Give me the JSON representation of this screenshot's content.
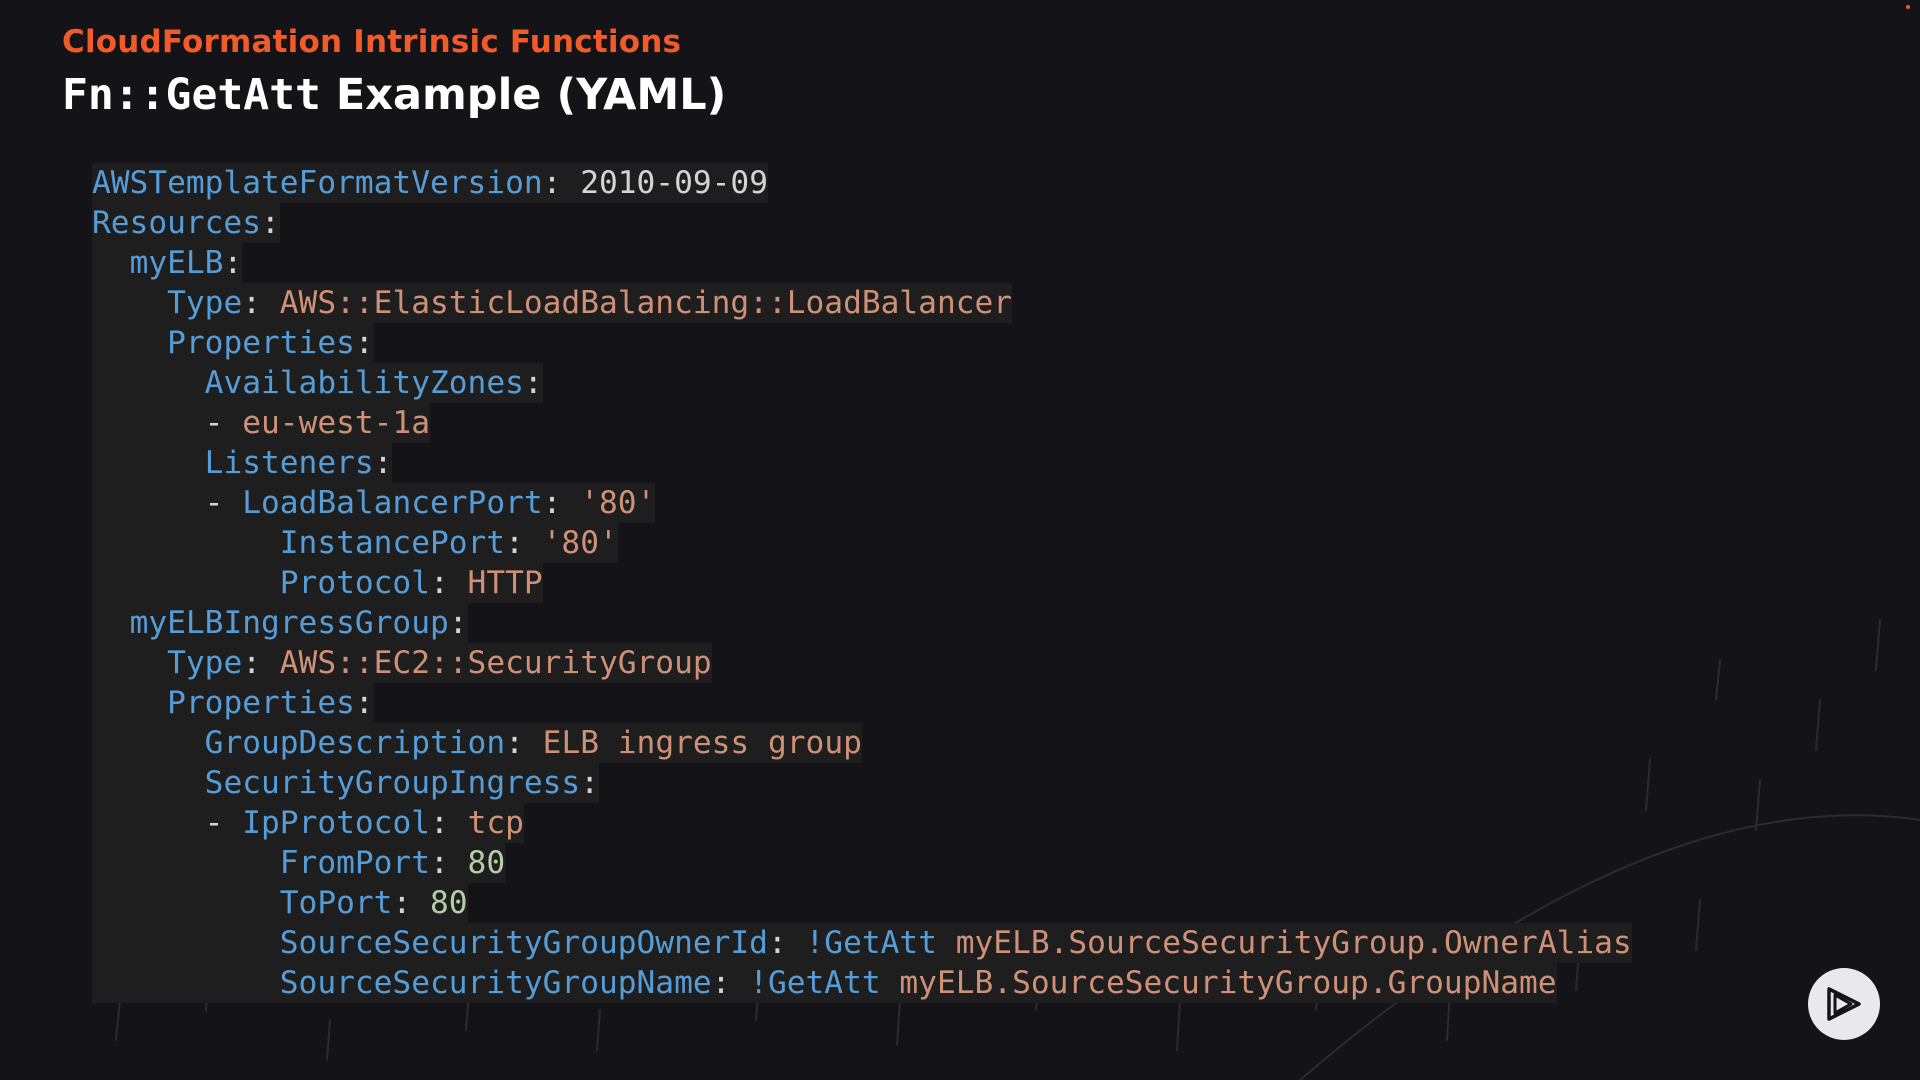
{
  "header": {
    "eyebrow": "CloudFormation Intrinsic Functions",
    "title_code": "Fn::GetAtt",
    "title_rest": " Example (YAML)"
  },
  "code": {
    "language": "yaml",
    "lines": [
      {
        "indent": 0,
        "key": "AWSTemplateFormatVersion",
        "sep": ": ",
        "value": "2010-09-09",
        "type": "plain"
      },
      {
        "indent": 0,
        "key": "Resources",
        "sep": ":",
        "value": "",
        "type": "none"
      },
      {
        "indent": 2,
        "key": "myELB",
        "sep": ":",
        "value": "",
        "type": "none"
      },
      {
        "indent": 4,
        "key": "Type",
        "sep": ": ",
        "value": "AWS::ElasticLoadBalancing::LoadBalancer",
        "type": "string"
      },
      {
        "indent": 4,
        "key": "Properties",
        "sep": ":",
        "value": "",
        "type": "none"
      },
      {
        "indent": 6,
        "key": "AvailabilityZones",
        "sep": ":",
        "value": "",
        "type": "none"
      },
      {
        "indent": 8,
        "dash": true,
        "key": "",
        "sep": "",
        "value": "eu-west-1a",
        "type": "string"
      },
      {
        "indent": 6,
        "key": "Listeners",
        "sep": ":",
        "value": "",
        "type": "none"
      },
      {
        "indent": 8,
        "dash": true,
        "key": "LoadBalancerPort",
        "sep": ": ",
        "value": "'80'",
        "type": "string"
      },
      {
        "indent": 10,
        "key": "InstancePort",
        "sep": ": ",
        "value": "'80'",
        "type": "string"
      },
      {
        "indent": 10,
        "key": "Protocol",
        "sep": ": ",
        "value": "HTTP",
        "type": "string"
      },
      {
        "indent": 2,
        "key": "myELBIngressGroup",
        "sep": ":",
        "value": "",
        "type": "none"
      },
      {
        "indent": 4,
        "key": "Type",
        "sep": ": ",
        "value": "AWS::EC2::SecurityGroup",
        "type": "string"
      },
      {
        "indent": 4,
        "key": "Properties",
        "sep": ":",
        "value": "",
        "type": "none"
      },
      {
        "indent": 6,
        "key": "GroupDescription",
        "sep": ": ",
        "value": "ELB ingress group",
        "type": "string"
      },
      {
        "indent": 6,
        "key": "SecurityGroupIngress",
        "sep": ":",
        "value": "",
        "type": "none"
      },
      {
        "indent": 8,
        "dash": true,
        "key": "IpProtocol",
        "sep": ": ",
        "value": "tcp",
        "type": "string"
      },
      {
        "indent": 10,
        "key": "FromPort",
        "sep": ": ",
        "value": "80",
        "type": "number"
      },
      {
        "indent": 10,
        "key": "ToPort",
        "sep": ": ",
        "value": "80",
        "type": "number"
      },
      {
        "indent": 10,
        "key": "SourceSecurityGroupOwnerId",
        "sep": ": ",
        "tag": "!GetAtt",
        "value": "myELB.SourceSecurityGroup.OwnerAlias",
        "type": "string"
      },
      {
        "indent": 10,
        "key": "SourceSecurityGroupName",
        "sep": ": ",
        "tag": "!GetAtt",
        "value": "myELB.SourceSecurityGroup.GroupName",
        "type": "string"
      }
    ]
  },
  "controls": {
    "play_icon": "play-icon"
  },
  "colors": {
    "background": "#141317",
    "code_background": "#1e1e1e",
    "accent": "#f15b2a",
    "key": "#569cd6",
    "string": "#ce9178",
    "number": "#b5cea8",
    "plain": "#d4d4d4"
  }
}
